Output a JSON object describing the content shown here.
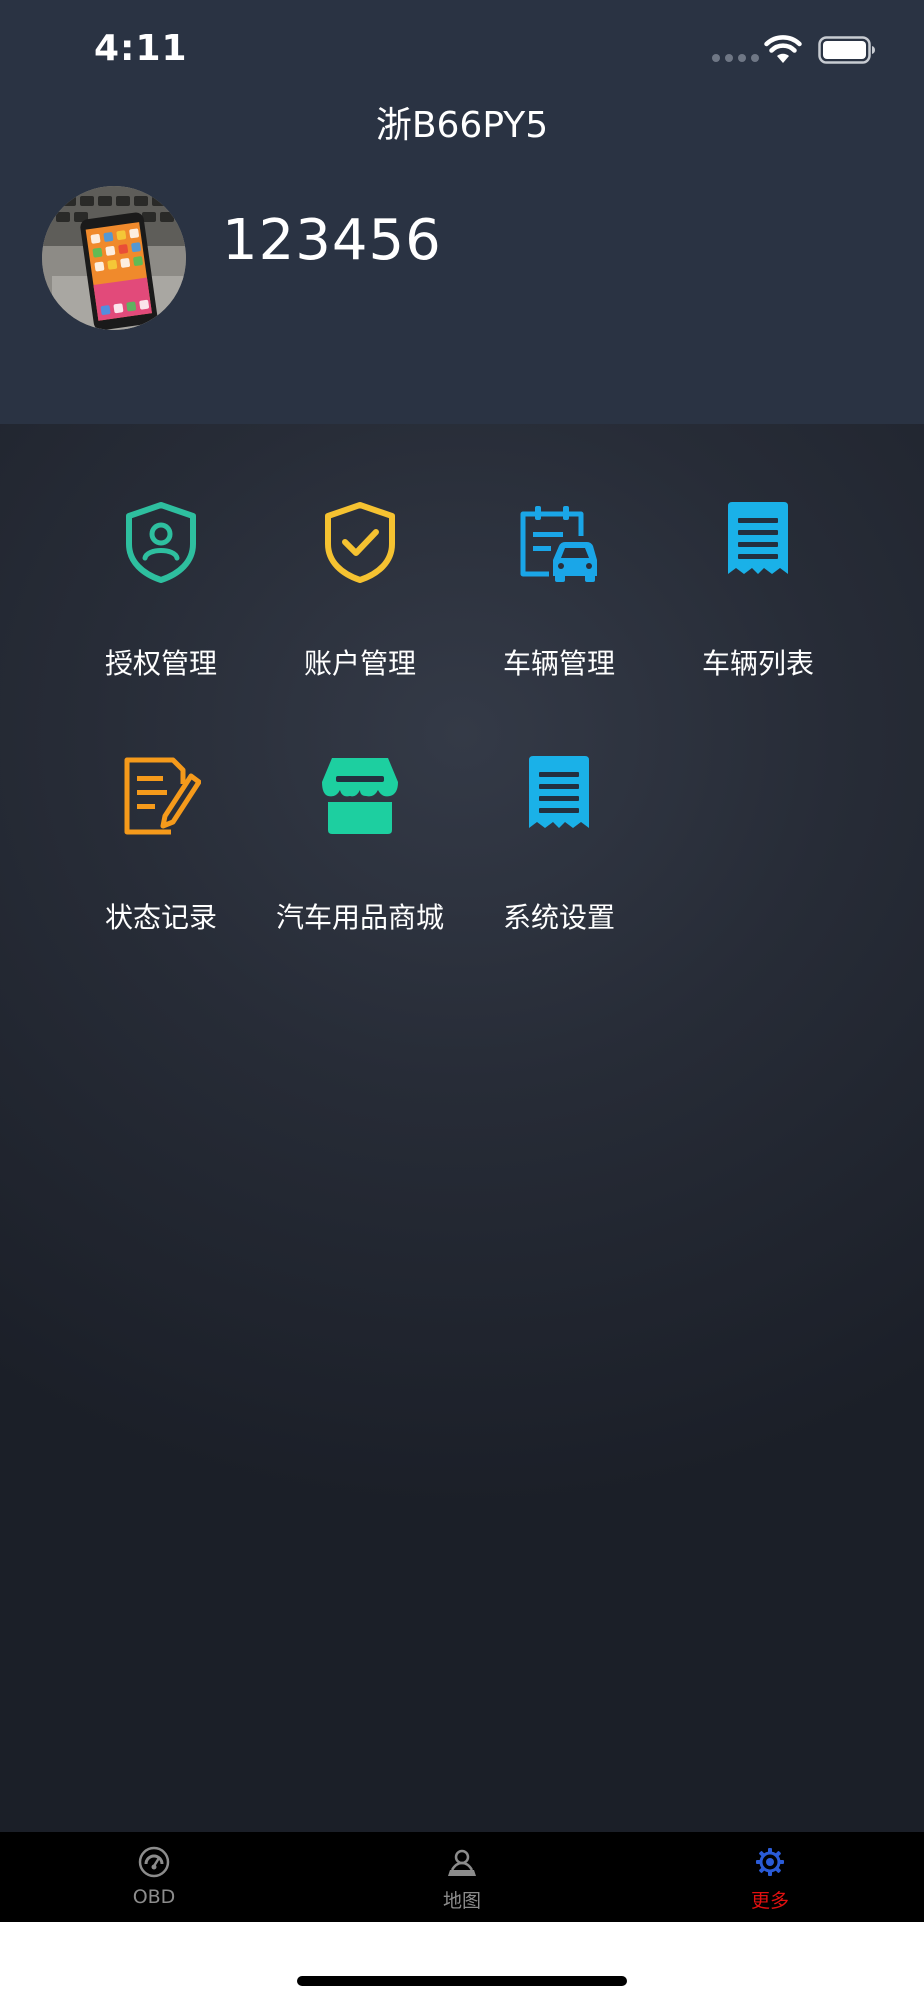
{
  "status_bar": {
    "time": "4:11"
  },
  "header": {
    "plate_number": "浙B66PY5",
    "user_id": "123456"
  },
  "menu": {
    "items": [
      {
        "label": "授权管理",
        "icon": "shield-user-icon",
        "color": "#2ebf9f"
      },
      {
        "label": "账户管理",
        "icon": "shield-check-icon",
        "color": "#f5c231"
      },
      {
        "label": "车辆管理",
        "icon": "clipboard-car-icon",
        "color": "#1aa6e8"
      },
      {
        "label": "车辆列表",
        "icon": "receipt-icon",
        "color": "#1ab1e8"
      },
      {
        "label": "状态记录",
        "icon": "document-edit-icon",
        "color": "#f59a1b"
      },
      {
        "label": "汽车用品商城",
        "icon": "store-icon",
        "color": "#1dcfa0"
      },
      {
        "label": "系统设置",
        "icon": "receipt-icon",
        "color": "#1ab1e8"
      }
    ]
  },
  "tabbar": {
    "tabs": [
      {
        "label": "OBD",
        "icon": "speedometer-icon",
        "active": false
      },
      {
        "label": "地图",
        "icon": "map-person-icon",
        "active": false
      },
      {
        "label": "更多",
        "icon": "gear-icon",
        "active": true
      }
    ],
    "active_color": "#e01010",
    "active_icon_color": "#2a5bd7"
  }
}
